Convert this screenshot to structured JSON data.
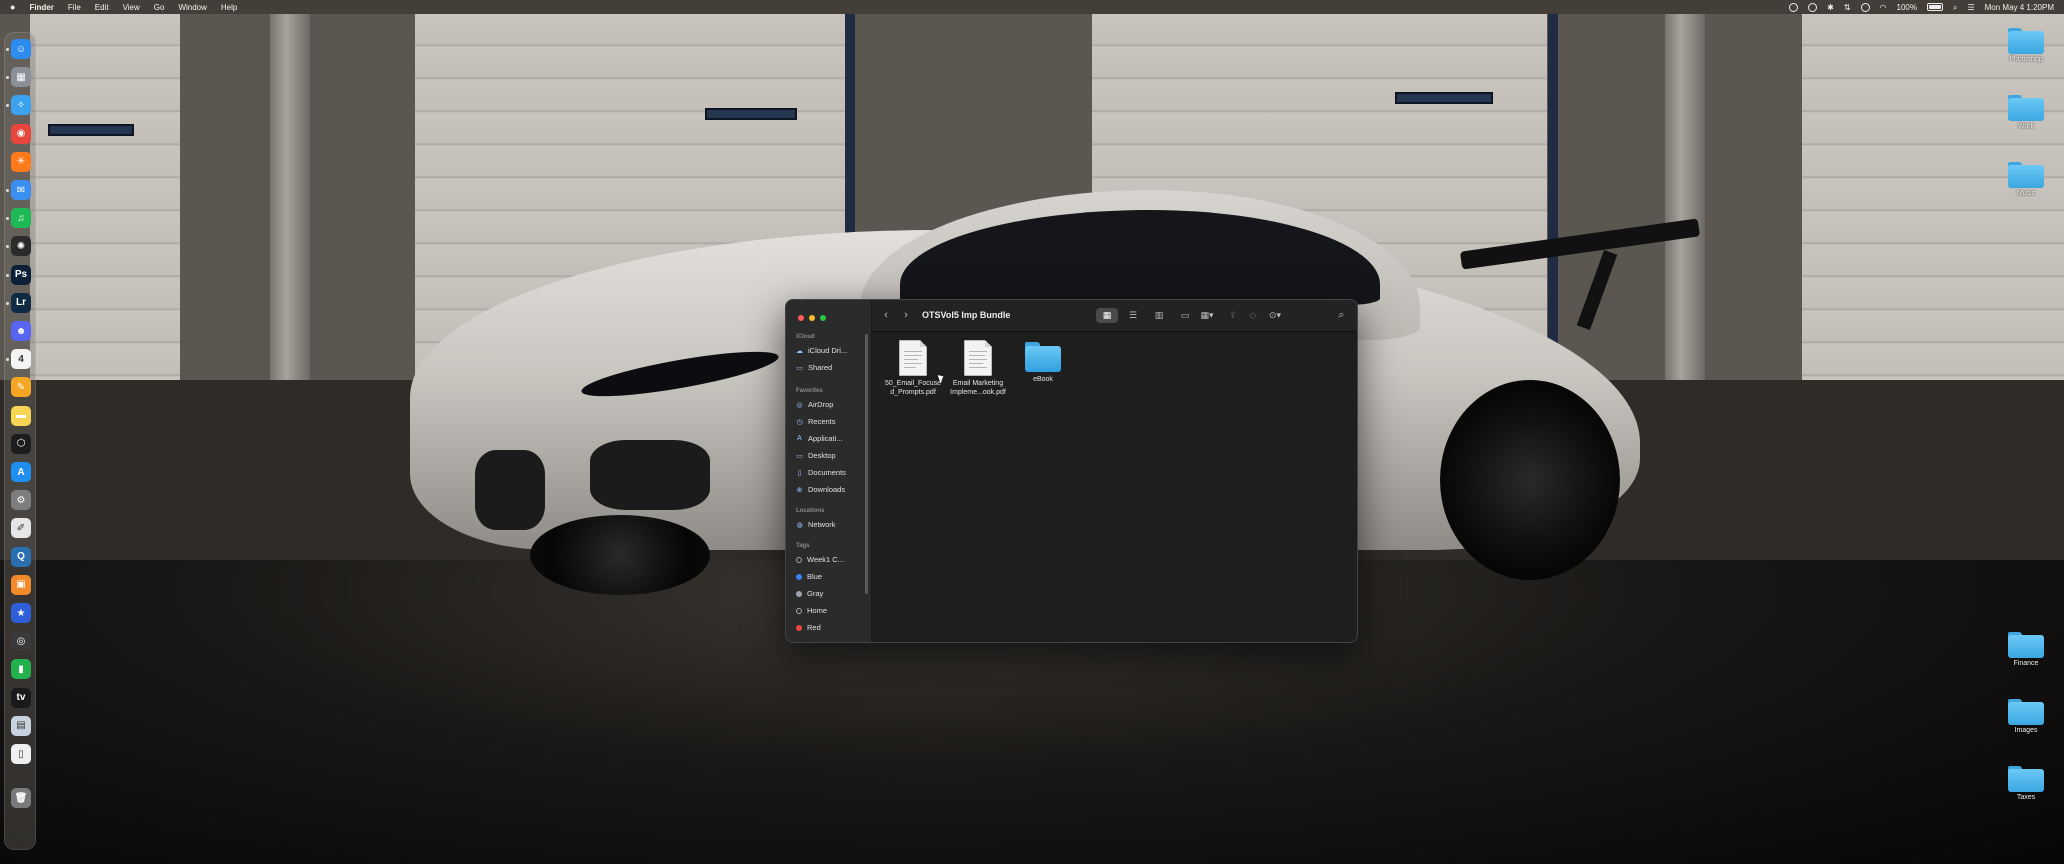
{
  "menubar": {
    "apple": "",
    "app_name": "Finder",
    "menus": [
      "File",
      "Edit",
      "View",
      "Go",
      "Window",
      "Help"
    ],
    "battery_percent": "100%",
    "datetime": "Mon May 4  1:20PM"
  },
  "dock": {
    "items": [
      {
        "name": "finder",
        "glyph": "☺",
        "color": "#2d8cf0"
      },
      {
        "name": "launchpad",
        "glyph": "▦",
        "color": "#8a8f98"
      },
      {
        "name": "safari",
        "glyph": "✧",
        "color": "#3ba2f0"
      },
      {
        "name": "chrome",
        "glyph": "◉",
        "color": "#e8453c"
      },
      {
        "name": "firefox",
        "glyph": "☀",
        "color": "#ff7a1a"
      },
      {
        "name": "mail",
        "glyph": "✉",
        "color": "#3b8ff0"
      },
      {
        "name": "spotify",
        "glyph": "♫",
        "color": "#1db954"
      },
      {
        "name": "chatgpt",
        "glyph": "✺",
        "color": "#2b2b2b"
      },
      {
        "name": "photoshop",
        "glyph": "Ps",
        "color": "#0d2038"
      },
      {
        "name": "lightroom",
        "glyph": "Lr",
        "color": "#0f2a44"
      },
      {
        "name": "discord",
        "glyph": "☻",
        "color": "#5865f2"
      },
      {
        "name": "calendar",
        "glyph": "4",
        "color": "#f4f4f4"
      },
      {
        "name": "pages",
        "glyph": "✎",
        "color": "#f5a623"
      },
      {
        "name": "notes",
        "glyph": "▬",
        "color": "#f7d451"
      },
      {
        "name": "openai",
        "glyph": "⬡",
        "color": "#1d1d1d"
      },
      {
        "name": "app-store",
        "glyph": "A",
        "color": "#1e8ff0"
      },
      {
        "name": "system-settings",
        "glyph": "⚙",
        "color": "#7d7d7d"
      },
      {
        "name": "textedit",
        "glyph": "✐",
        "color": "#e6e6e6"
      },
      {
        "name": "quicktime",
        "glyph": "Q",
        "color": "#2a6fb0"
      },
      {
        "name": "box-app",
        "glyph": "▣",
        "color": "#f28a2b"
      },
      {
        "name": "reeder",
        "glyph": "★",
        "color": "#2c5fd9"
      },
      {
        "name": "safari-tech",
        "glyph": "◎",
        "color": "#3a3a3a"
      },
      {
        "name": "numbers",
        "glyph": "▮",
        "color": "#22b14c"
      },
      {
        "name": "apple-tv",
        "glyph": "tv",
        "color": "#1a1a1a"
      },
      {
        "name": "preview",
        "glyph": "▤",
        "color": "#c9d3df"
      },
      {
        "name": "document",
        "glyph": "▯",
        "color": "#f0f0f0"
      },
      {
        "name": "trash",
        "glyph": "🗑",
        "color": "#7a7a7a"
      }
    ]
  },
  "desktop_folders": [
    {
      "name": "Photoshop"
    },
    {
      "name": "Work"
    },
    {
      "name": "Music"
    },
    {
      "name": "Finance"
    },
    {
      "name": "Images"
    },
    {
      "name": "Taxes"
    }
  ],
  "finder": {
    "title": "OTSVol5 Imp Bundle",
    "sidebar": {
      "icloud_header": "iCloud",
      "icloud_items": [
        "iCloud Dri...",
        "Shared"
      ],
      "favorites_header": "Favorites",
      "favorites_items": [
        "AirDrop",
        "Recents",
        "Applicati...",
        "Desktop",
        "Documents",
        "Downloads"
      ],
      "locations_header": "Locations",
      "locations_items": [
        "Network"
      ],
      "tags_header": "Tags",
      "tags_items": [
        {
          "label": "Week1 C...",
          "color": "hollow"
        },
        {
          "label": "Blue",
          "color": "#3b82f6"
        },
        {
          "label": "Gray",
          "color": "#9ca3af"
        },
        {
          "label": "Home",
          "color": "hollow"
        },
        {
          "label": "Red",
          "color": "#ef4444"
        }
      ]
    },
    "files": [
      {
        "line1": "50_Email_Focuse",
        "line2": "d_Prompts.pdf",
        "kind": "pdf"
      },
      {
        "line1": "Email Marketing",
        "line2": "Impleme...ook.pdf",
        "kind": "pdf"
      },
      {
        "line1": "eBook",
        "line2": "",
        "kind": "folder"
      }
    ]
  }
}
